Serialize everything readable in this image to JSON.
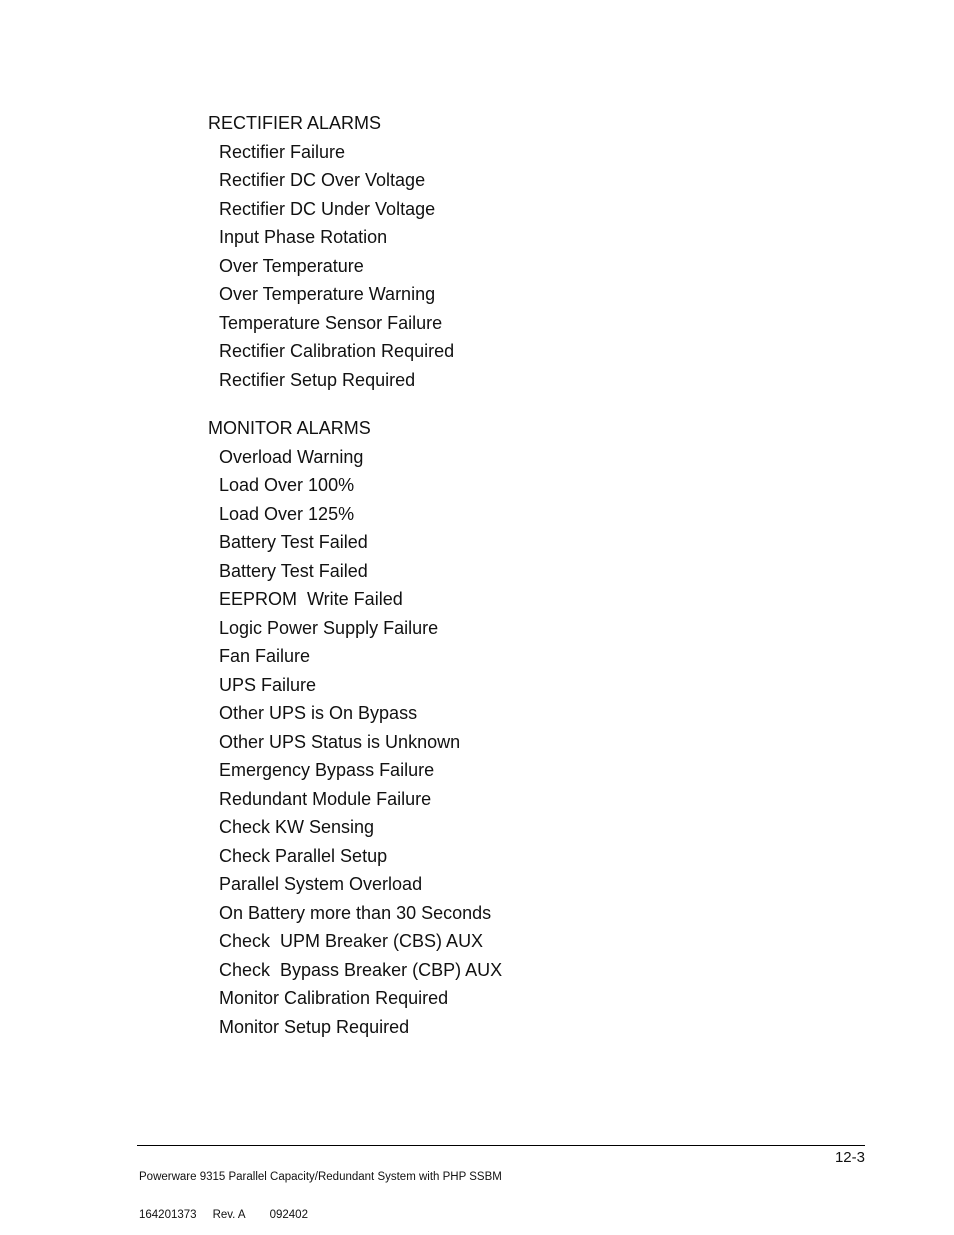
{
  "sections": [
    {
      "heading": "RECTIFIER ALARMS",
      "items": [
        "Rectifier Failure",
        "Rectifier DC Over Voltage",
        "Rectifier DC Under Voltage",
        "Input Phase Rotation",
        "Over Temperature",
        "Over Temperature Warning",
        "Temperature Sensor Failure",
        "Rectifier Calibration Required",
        "Rectifier Setup Required"
      ]
    },
    {
      "heading": "MONITOR ALARMS",
      "items": [
        "Overload Warning",
        "Load Over 100%",
        "Load Over 125%",
        "Battery Test Failed",
        "Battery Test Failed",
        "EEPROM  Write Failed",
        "Logic Power Supply Failure",
        "Fan Failure",
        "UPS Failure",
        "Other UPS is On Bypass",
        "Other UPS Status is Unknown",
        "Emergency Bypass Failure",
        "Redundant Module Failure",
        "Check KW Sensing",
        "Check Parallel Setup",
        "Parallel System Overload",
        "On Battery more than 30 Seconds",
        "Check  UPM Breaker (CBS) AUX",
        "Check  Bypass Breaker (CBP) AUX",
        "Monitor Calibration Required",
        "Monitor Setup Required"
      ]
    }
  ],
  "footer": {
    "title": "Powerware 9315 Parallel Capacity/Redundant System with PHP SSBM",
    "part_number": "164201373",
    "revision": "Rev. A",
    "date_code": "092402",
    "page_number": "12-3"
  }
}
